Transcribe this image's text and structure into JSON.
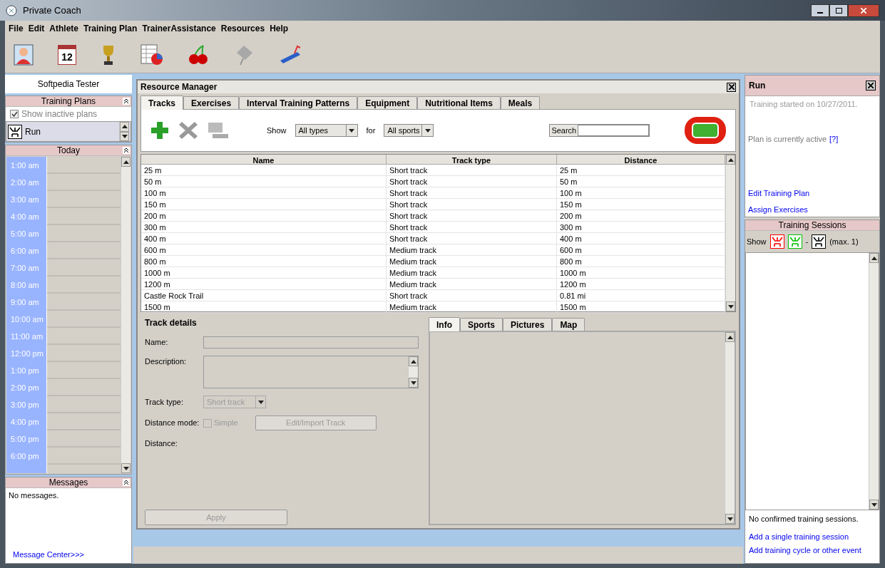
{
  "window": {
    "title": "Private Coach"
  },
  "menu": [
    "File",
    "Edit",
    "Athlete",
    "Training Plan",
    "TrainerAssistance",
    "Resources",
    "Help"
  ],
  "toolbar": {
    "calendar_day": "12"
  },
  "left": {
    "athlete": "Softpedia Tester",
    "training_plans": {
      "title": "Training Plans",
      "show_inactive": {
        "label": "Show inactive plans",
        "checked": true
      },
      "plans": [
        {
          "name": "Run",
          "selected": true
        }
      ]
    },
    "today": {
      "title": "Today",
      "hours": [
        "1:00 am",
        "2:00 am",
        "3:00 am",
        "4:00 am",
        "5:00 am",
        "6:00 am",
        "7:00 am",
        "8:00 am",
        "9:00 am",
        "10:00 am",
        "11:00 am",
        "12:00 pm",
        "1:00 pm",
        "2:00 pm",
        "3:00 pm",
        "4:00 pm",
        "5:00 pm",
        "6:00 pm"
      ]
    },
    "messages": {
      "title": "Messages",
      "text": "No messages.",
      "link": "Message Center>>>"
    }
  },
  "resource_manager": {
    "title": "Resource Manager",
    "tabs": [
      {
        "label": "Tracks",
        "selected": true
      },
      {
        "label": "Exercises",
        "selected": false
      },
      {
        "label": "Interval Training Patterns",
        "selected": false
      },
      {
        "label": "Equipment",
        "selected": false
      },
      {
        "label": "Nutritional Items",
        "selected": false
      },
      {
        "label": "Meals",
        "selected": false
      }
    ],
    "filter": {
      "show_label": "Show",
      "type": "All types",
      "for_label": "for",
      "sport": "All sports",
      "search_label": "Search"
    },
    "table": {
      "columns": [
        "Name",
        "Track type",
        "Distance"
      ],
      "rows": [
        [
          "25 m",
          "Short track",
          "25 m"
        ],
        [
          "50 m",
          "Short track",
          "50 m"
        ],
        [
          "100 m",
          "Short track",
          "100 m"
        ],
        [
          "150 m",
          "Short track",
          "150 m"
        ],
        [
          "200 m",
          "Short track",
          "200 m"
        ],
        [
          "300 m",
          "Short track",
          "300 m"
        ],
        [
          "400 m",
          "Short track",
          "400 m"
        ],
        [
          "600 m",
          "Medium track",
          "600 m"
        ],
        [
          "800 m",
          "Medium track",
          "800 m"
        ],
        [
          "1000 m",
          "Medium track",
          "1000 m"
        ],
        [
          "1200 m",
          "Medium track",
          "1200 m"
        ],
        [
          "Castle Rock Trail",
          "Short track",
          "0.81 mi"
        ],
        [
          "1500 m",
          "Medium track",
          "1500 m"
        ]
      ]
    },
    "details": {
      "title": "Track details",
      "name_label": "Name:",
      "description_label": "Description:",
      "track_type_label": "Track type:",
      "track_type": "Short track",
      "distance_mode_label": "Distance mode:",
      "simple": {
        "label": "Simple",
        "checked": false
      },
      "edit_button": "Edit/Import Track",
      "distance_label": "Distance:",
      "apply": "Apply"
    },
    "detail_tabs": [
      {
        "label": "Info",
        "selected": true
      },
      {
        "label": "Sports",
        "selected": false
      },
      {
        "label": "Pictures",
        "selected": false
      },
      {
        "label": "Map",
        "selected": false
      }
    ]
  },
  "right": {
    "plan": {
      "title": "Run",
      "started": "Training started on 10/27/2011.",
      "status": "Plan is currently active",
      "help_link": "[?]",
      "links": [
        "Edit Training Plan",
        "Assign Exercises"
      ]
    },
    "sessions": {
      "title": "Training Sessions",
      "show_label": "Show",
      "filters": [
        {
          "color": "#ff0000"
        },
        {
          "color": "#00c000"
        },
        {
          "color": "#000000"
        }
      ],
      "separator": "-",
      "max": "(max. 1)",
      "empty": "No confirmed training sessions.",
      "links": [
        "Add a single training session",
        "Add training cycle or other event"
      ]
    }
  }
}
